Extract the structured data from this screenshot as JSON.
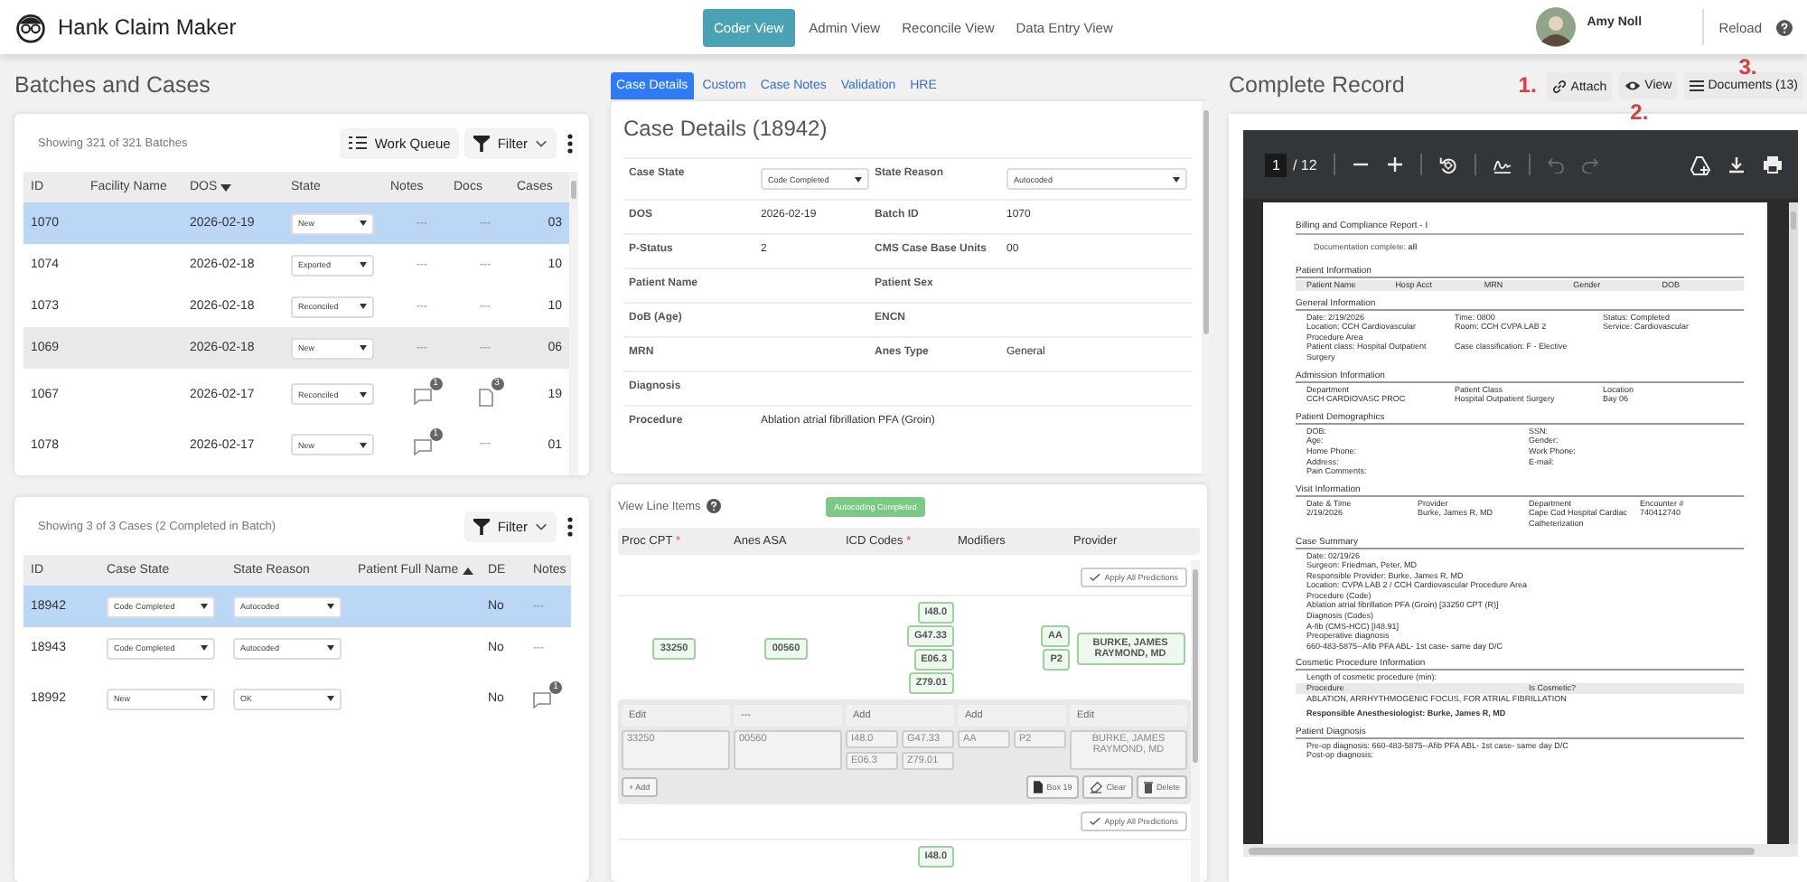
{
  "app": {
    "title": "Hank Claim Maker"
  },
  "nav": [
    {
      "label": "Coder View",
      "selected": true
    },
    {
      "label": "Admin View",
      "selected": false
    },
    {
      "label": "Reconcile View",
      "selected": false
    },
    {
      "label": "Data Entry View",
      "selected": false
    }
  ],
  "user": {
    "name": "Amy Noll"
  },
  "reload": "Reload",
  "batches_title": "Batches and Cases",
  "batches": {
    "summary": "Showing 321 of 321 Batches",
    "work_queue": "Work Queue",
    "filter": "Filter",
    "columns": [
      {
        "label": "ID",
        "kind": "plain"
      },
      {
        "label": "Facility Name",
        "kind": "plain"
      },
      {
        "label": "DOS",
        "kind": "sorted_desc"
      },
      {
        "label": "State",
        "kind": "plain"
      },
      {
        "label": "Notes",
        "kind": "plain"
      },
      {
        "label": "Docs",
        "kind": "plain"
      },
      {
        "label": "Cases",
        "kind": "plain"
      }
    ],
    "rows": [
      {
        "id": "1070",
        "dos": "2026-02-19",
        "state": "New",
        "notes": "---",
        "docs": "---",
        "cases": "03",
        "selected": true,
        "hovered": false
      },
      {
        "id": "1074",
        "dos": "2026-02-18",
        "state": "Exported",
        "notes": "---",
        "docs": "---",
        "cases": "10",
        "selected": false,
        "hovered": false
      },
      {
        "id": "1073",
        "dos": "2026-02-18",
        "state": "Reconciled",
        "notes": "---",
        "docs": "---",
        "cases": "10",
        "selected": false,
        "hovered": false
      },
      {
        "id": "1069",
        "dos": "2026-02-18",
        "state": "New",
        "notes": "---",
        "docs": "---",
        "cases": "06",
        "selected": false,
        "hovered": true
      },
      {
        "id": "1067",
        "dos": "2026-02-17",
        "state": "Reconciled",
        "notes_count": "1",
        "docs_count": "3",
        "cases": "19",
        "selected": false,
        "hovered": false
      },
      {
        "id": "1078",
        "dos": "2026-02-17",
        "state": "New",
        "notes_count": "1",
        "docs": "---",
        "cases": "01",
        "selected": false,
        "hovered": false
      }
    ]
  },
  "cases": {
    "summary": "Showing 3 of 3 Cases (2 Completed in Batch)",
    "filter": "Filter",
    "columns": [
      {
        "label": "ID",
        "kind": "plain"
      },
      {
        "label": "Case State",
        "kind": "plain"
      },
      {
        "label": "State Reason",
        "kind": "plain"
      },
      {
        "label": "Patient Full Name",
        "kind": "sorted_asc"
      },
      {
        "label": "DE",
        "kind": "plain"
      },
      {
        "label": "Notes",
        "kind": "plain"
      }
    ],
    "rows": [
      {
        "id": "18942",
        "case_state": "Code Completed",
        "state_reason": "Autocoded",
        "de": "No",
        "notes": "---",
        "selected": true
      },
      {
        "id": "18943",
        "case_state": "Code Completed",
        "state_reason": "Autocoded",
        "de": "No",
        "notes": "---",
        "selected": false
      },
      {
        "id": "18992",
        "case_state": "New",
        "state_reason": "OK",
        "de": "No",
        "notes_count": "1",
        "selected": false
      }
    ]
  },
  "case_tabs": [
    {
      "label": "Case Details",
      "selected": true
    },
    {
      "label": "Custom",
      "selected": false
    },
    {
      "label": "Case Notes",
      "selected": false
    },
    {
      "label": "Validation",
      "selected": false
    },
    {
      "label": "HRE",
      "selected": false
    }
  ],
  "case_details": {
    "title": "Case Details (18942)",
    "rows": [
      {
        "wide": false,
        "cells": [
          {
            "label": "Case State",
            "value": "Code Completed",
            "kind": "select"
          },
          {
            "label": "State Reason",
            "value": "Autocoded",
            "kind": "select"
          }
        ]
      },
      {
        "wide": false,
        "cells": [
          {
            "label": "DOS",
            "value": "2026-02-19",
            "kind": "text"
          },
          {
            "label": "Batch ID",
            "value": "1070",
            "kind": "text"
          }
        ]
      },
      {
        "wide": false,
        "cells": [
          {
            "label": "P-Status",
            "value": "2",
            "kind": "text"
          },
          {
            "label": "CMS Case Base Units",
            "value": "00",
            "kind": "text"
          }
        ]
      },
      {
        "wide": false,
        "cells": [
          {
            "label": "Patient Name",
            "kind": "text"
          },
          {
            "label": "Patient Sex",
            "kind": "text"
          }
        ]
      },
      {
        "wide": false,
        "cells": [
          {
            "label": "DoB (Age)",
            "kind": "text"
          },
          {
            "label": "ENCN",
            "kind": "text"
          }
        ]
      },
      {
        "wide": false,
        "cells": [
          {
            "label": "MRN",
            "kind": "text"
          },
          {
            "label": "Anes Type",
            "value": "General",
            "kind": "text"
          }
        ]
      },
      {
        "wide": false,
        "cells": [
          {
            "label": "Diagnosis",
            "kind": "text"
          }
        ]
      },
      {
        "wide": true,
        "cells": [
          {
            "label": "Procedure",
            "value": "Ablation atrial fibrillation PFA (Groin)",
            "kind": "text"
          }
        ]
      }
    ]
  },
  "line_items": {
    "title": "View Line Items",
    "status": "Autocoding Completed",
    "columns": [
      {
        "label": "Proc CPT",
        "required_mark": "*"
      },
      {
        "label": "Anes ASA"
      },
      {
        "label": "ICD Codes",
        "required_mark": "*"
      },
      {
        "label": "Modifiers"
      },
      {
        "label": "Provider"
      }
    ],
    "items": [
      {
        "apply": "Apply All Predictions",
        "cpt": "33250",
        "asa": "00560",
        "icd": [
          "I48.0",
          "G47.33",
          "E06.3",
          "Z79.01"
        ],
        "modifiers": [
          "AA",
          "P2"
        ],
        "provider": "BURKE, JAMES RAYMOND, MD",
        "editor": {
          "headers": [
            "Edit",
            "---",
            "Add",
            "Add",
            "Edit"
          ],
          "cpt": "33250",
          "asa": "00560",
          "icd": [
            "I48.0",
            "G47.33",
            "E06.3",
            "Z79.01"
          ],
          "modifiers": [
            "AA",
            "P2"
          ],
          "provider": "BURKE, JAMES RAYMOND, MD",
          "add": "+ Add",
          "box19": "Box 19",
          "clear": "Clear",
          "delete": "Delete"
        }
      },
      {
        "apply": "Apply All Predictions",
        "icd": [
          "I48.0"
        ]
      }
    ]
  },
  "record": {
    "title": "Complete Record",
    "actions": [
      {
        "label": "Attach",
        "kind": "attach",
        "annotation": "1."
      },
      {
        "label": "View",
        "kind": "view",
        "annotation": "2."
      },
      {
        "label": "Documents (13)",
        "kind": "documents",
        "annotation": "3."
      }
    ],
    "viewer": {
      "page": "1",
      "page_count": "/ 12",
      "document": {
        "title": "Billing and Compliance Report - I",
        "note": "Documentation complete: **all**",
        "sections": [
          {
            "heading": "Patient Information",
            "rows": [
              {
                "kind": "header",
                "cells": [
                  "Patient Name",
                  "Hosp Acct",
                  "MRN",
                  "Gender",
                  "DOB"
                ]
              }
            ]
          },
          {
            "heading": "General Information",
            "rows": [
              {
                "kind": "plain",
                "cells": [
                  "Date: 2/19/2026",
                  "Time: 0800",
                  "Status: Completed"
                ]
              },
              {
                "kind": "plain",
                "cells": [
                  "Location: CCH Cardiovascular Procedure Area",
                  "Room: CCH CVPA LAB 2",
                  "Service: Cardiovascular"
                ]
              },
              {
                "kind": "plain",
                "cells": [
                  "Patient class: Hospital Outpatient Surgery",
                  "Case classification: F - Elective"
                ]
              }
            ]
          },
          {
            "heading": "Admission Information",
            "rows": [
              {
                "kind": "plain",
                "cells": [
                  "Department",
                  "Patient Class",
                  "Location"
                ]
              },
              {
                "kind": "plain",
                "cells": [
                  "CCH CARDIOVASC PROC",
                  "Hospital Outpatient Surgery",
                  "Bay 06"
                ]
              }
            ]
          },
          {
            "heading": "Patient Demographics",
            "rows": [
              {
                "kind": "plain",
                "cells": [
                  "DOB:",
                  "SSN:"
                ]
              },
              {
                "kind": "plain",
                "cells": [
                  "Age:",
                  "Gender:"
                ]
              },
              {
                "kind": "plain",
                "cells": [
                  "Home Phone:",
                  "Work Phone:"
                ]
              },
              {
                "kind": "plain",
                "cells": [
                  "Address:",
                  "E-mail:"
                ]
              },
              {
                "kind": "plain",
                "cells": [
                  "Pain Comments:"
                ]
              }
            ]
          },
          {
            "heading": "Visit Information",
            "rows": [
              {
                "kind": "plain",
                "cells": [
                  "Date & Time",
                  "Provider",
                  "Department",
                  "Encounter #"
                ]
              },
              {
                "kind": "plain",
                "cells": [
                  "2/19/2026",
                  "Burke, James R, MD",
                  "Cape Cod Hospital Cardiac Catheterization",
                  "740412740"
                ]
              }
            ]
          },
          {
            "heading": "Case Summary",
            "rows": [
              {
                "kind": "plain",
                "cells": [
                  "Date: 02/19/26"
                ]
              },
              {
                "kind": "plain",
                "cells": [
                  "Surgeon: Friedman, Peter, MD"
                ]
              },
              {
                "kind": "plain",
                "cells": [
                  "Responsible Provider: Burke, James R, MD"
                ]
              },
              {
                "kind": "plain",
                "cells": [
                  "Location: CVPA LAB 2 / CCH Cardiovascular Procedure Area"
                ]
              },
              {
                "kind": "plain",
                "cells": [
                  "Procedure (Code)"
                ]
              },
              {
                "kind": "plain",
                "cells": [
                  "Ablation atrial fibrillation PFA (Groin) [33250 CPT (R)]"
                ]
              },
              {
                "kind": "plain",
                "cells": [
                  "Diagnosis (Codes)"
                ]
              },
              {
                "kind": "plain",
                "cells": [
                  "A-fib (CMS-HCC) [I48.91]"
                ]
              },
              {
                "kind": "plain",
                "cells": [
                  "Preoperative diagnosis"
                ]
              },
              {
                "kind": "plain",
                "cells": [
                  "660-483-5875--Afib PFA ABL- 1st case- same day D/C"
                ]
              }
            ]
          },
          {
            "heading": "Cosmetic Procedure Information",
            "rows": [
              {
                "kind": "plain",
                "cells": [
                  "Length of cosmetic procedure (min):"
                ]
              },
              {
                "kind": "header",
                "cells": [
                  "Procedure",
                  "Is Cosmetic?"
                ]
              },
              {
                "kind": "plain",
                "cells": [
                  "ABLATION, ARRHYTHMOGENIC FOCUS, FOR ATRIAL FIBRILLATION"
                ]
              },
              {
                "kind": "bold",
                "cells": [
                  "Responsible Anesthesiologist: Burke, James R, MD"
                ]
              }
            ]
          },
          {
            "heading": "Patient Diagnosis",
            "rows": [
              {
                "kind": "plain",
                "cells": [
                  "Pre-op diagnosis: 660-483-5875--Afib PFA ABL- 1st case- same day D/C"
                ]
              },
              {
                "kind": "plain",
                "cells": [
                  "Post-op diagnosis:"
                ]
              }
            ]
          }
        ]
      }
    }
  }
}
